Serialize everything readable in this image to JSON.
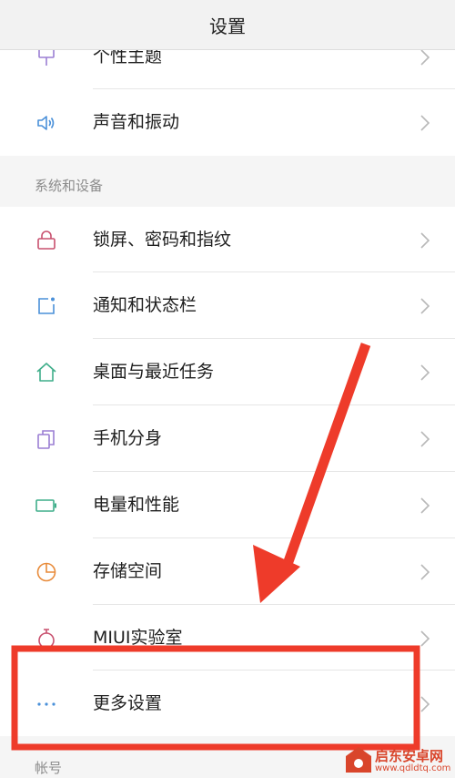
{
  "header": {
    "title": "设置"
  },
  "top_items": [
    {
      "label": "个性主题",
      "icon": "theme-brush-icon"
    },
    {
      "label": "声音和振动",
      "icon": "speaker-icon"
    }
  ],
  "section_system": {
    "label": "系统和设备",
    "items": [
      {
        "label": "锁屏、密码和指纹",
        "icon": "lock-icon"
      },
      {
        "label": "通知和状态栏",
        "icon": "notification-icon"
      },
      {
        "label": "桌面与最近任务",
        "icon": "home-icon"
      },
      {
        "label": "手机分身",
        "icon": "dual-phone-icon"
      },
      {
        "label": "电量和性能",
        "icon": "battery-icon"
      },
      {
        "label": "存储空间",
        "icon": "storage-pie-icon"
      },
      {
        "label": "MIUI实验室",
        "icon": "flask-icon"
      },
      {
        "label": "更多设置",
        "icon": "more-dots-icon"
      }
    ]
  },
  "section_account": {
    "label": "帐号"
  },
  "colors": {
    "annotation_red": "#ee3b2a",
    "icon_purple": "#9b7fd4",
    "icon_blue": "#4a90d9",
    "icon_pink": "#c8506e",
    "icon_green": "#3fae8a",
    "icon_orange": "#e88b3a"
  },
  "watermark": {
    "name": "启东安卓网",
    "url": "www.qdldtq.com"
  }
}
